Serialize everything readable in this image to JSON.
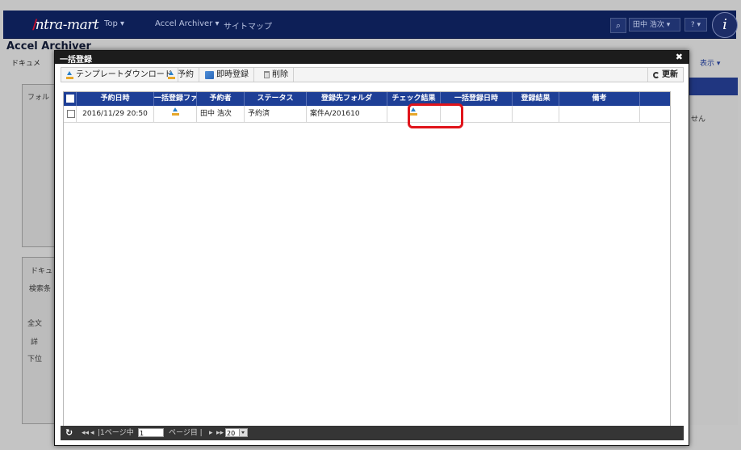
{
  "app": {
    "logo_text": "ntra-mart",
    "title": "Accel Archiver",
    "nav": {
      "top": "Top ▾",
      "archiver": "Accel Archiver ▾",
      "sitemap": "サイトマップ"
    },
    "user": "田中 浩次 ▾",
    "help": "? ▾",
    "doc_tab": "ドキュメ",
    "view_menu": "表示 ▾",
    "left_panel": {
      "folder_label": "フォル",
      "doc_label": "ドキュ",
      "search_label": "検索条",
      "fulltext": "全文",
      "detail": "詳",
      "lower": "下位"
    },
    "right_panel_text": "せん"
  },
  "modal": {
    "title": "一括登録",
    "toolbar": {
      "template_download": "テンプレートダウンロード",
      "reserve": "予約",
      "instant_register": "即時登録",
      "delete": "削除",
      "refresh": "更新"
    },
    "grid": {
      "columns": [
        "予約日時",
        "一括登録ファ",
        "予約者",
        "ステータス",
        "登録先フォルダ",
        "チェック結果",
        "一括登録日時",
        "登録結果",
        "備考"
      ],
      "rows": [
        {
          "reserved_at": "2016/11/29 20:50",
          "user": "田中 浩次",
          "status": "予約済",
          "folder": "案件A/201610",
          "registered_at": "",
          "result": "",
          "note": ""
        }
      ]
    },
    "pager": {
      "page_label": "|1ページ中",
      "page_value": "1",
      "page_suffix": "ページ目 |",
      "page_size": "20"
    }
  }
}
